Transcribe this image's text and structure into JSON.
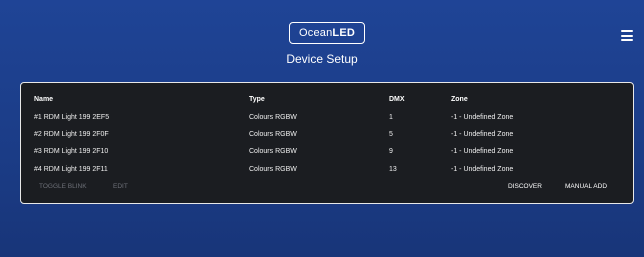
{
  "header": {
    "logo": {
      "part1": "Ocean",
      "part2": "LED"
    },
    "title": "Device Setup",
    "menu_icon": "hamburger-menu-icon"
  },
  "table": {
    "columns": [
      "Name",
      "Type",
      "DMX",
      "Zone"
    ],
    "rows": [
      {
        "name": "#1 RDM Light 199 2EF5",
        "type": "Colours RGBW",
        "dmx": "1",
        "zone": "-1 - Undefined Zone"
      },
      {
        "name": "#2 RDM Light 199 2F0F",
        "type": "Colours RGBW",
        "dmx": "5",
        "zone": "-1 - Undefined Zone"
      },
      {
        "name": "#3 RDM Light 199 2F10",
        "type": "Colours RGBW",
        "dmx": "9",
        "zone": "-1 - Undefined Zone"
      },
      {
        "name": "#4 RDM Light 199 2F11",
        "type": "Colours RGBW",
        "dmx": "13",
        "zone": "-1 - Undefined Zone"
      }
    ]
  },
  "actions": {
    "toggle_blink": "TOGGLE BLINK",
    "edit": "EDIT",
    "discover": "DISCOVER",
    "manual_add": "MANUAL ADD"
  },
  "colors": {
    "background": "#1d3f8a",
    "panel": "#1b1d21",
    "panel_border": "#e8e8e8",
    "disabled_text": "#6d7078"
  }
}
